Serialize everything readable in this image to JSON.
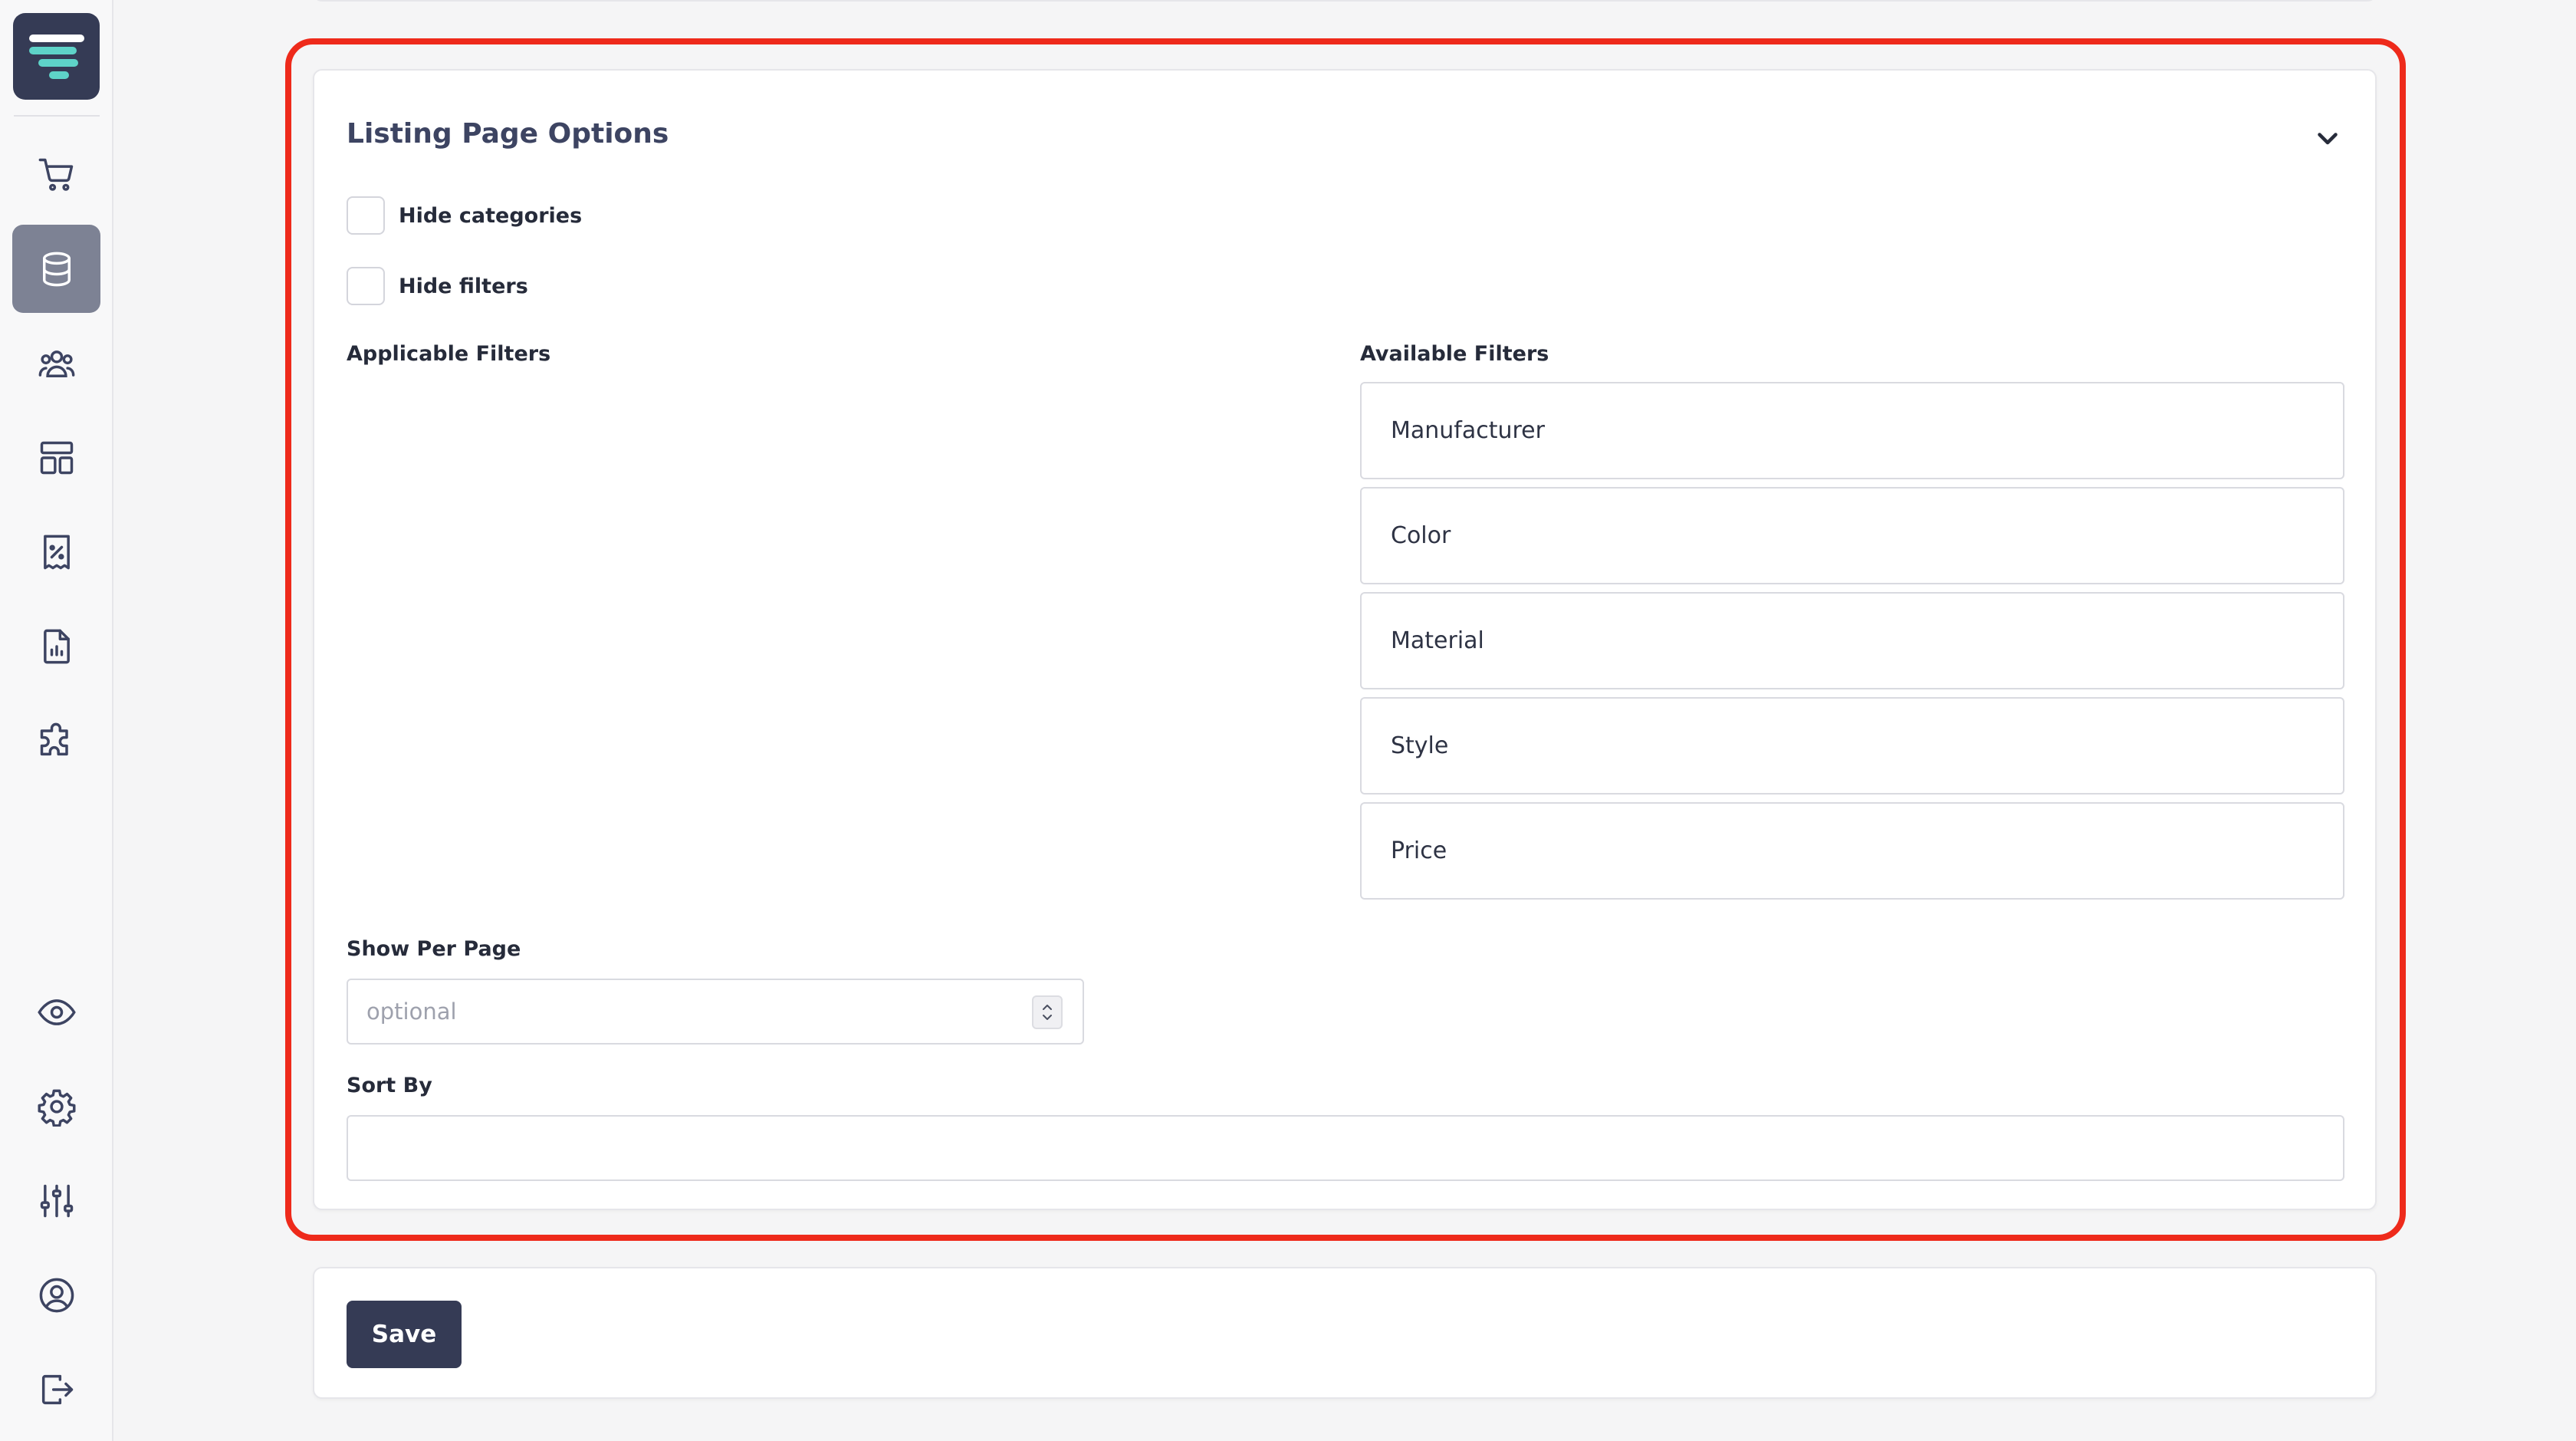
{
  "sidebar": {
    "logo": "logo-icon",
    "items": [
      {
        "name": "cart-icon",
        "active": false
      },
      {
        "name": "database-icon",
        "active": true
      },
      {
        "name": "users-icon",
        "active": false
      },
      {
        "name": "layout-icon",
        "active": false
      },
      {
        "name": "receipt-percent-icon",
        "active": false
      },
      {
        "name": "report-icon",
        "active": false
      },
      {
        "name": "puzzle-icon",
        "active": false
      },
      {
        "name": "eye-icon",
        "active": false
      },
      {
        "name": "gear-icon",
        "active": false
      },
      {
        "name": "sliders-icon",
        "active": false
      },
      {
        "name": "user-circle-icon",
        "active": false
      },
      {
        "name": "logout-icon",
        "active": false
      }
    ]
  },
  "listing": {
    "title": "Listing Page Options",
    "hide_categories_label": "Hide categories",
    "hide_filters_label": "Hide filters",
    "applicable_filters_label": "Applicable Filters",
    "available_filters_label": "Available Filters",
    "available_filters": [
      "Manufacturer",
      "Color",
      "Material",
      "Style",
      "Price"
    ],
    "show_per_page_label": "Show Per Page",
    "show_per_page_placeholder": "optional",
    "sort_by_label": "Sort By"
  },
  "actions": {
    "save_label": "Save"
  },
  "colors": {
    "accent": "#353b55",
    "highlight": "#ee2a1b",
    "active_nav": "#7d8294"
  }
}
